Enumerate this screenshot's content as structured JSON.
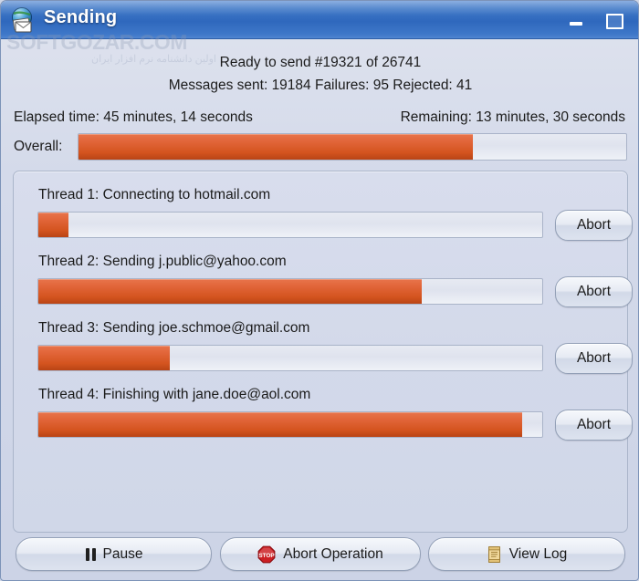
{
  "window": {
    "title": "Sending",
    "icon": "mail-globe-icon",
    "controls": {
      "minimize": "minimize-icon",
      "maximize": "maximize-icon"
    }
  },
  "watermark": {
    "main": "SOFTGOZAR.COM",
    "sub": "اولین دانشنامه نرم افزار ایران"
  },
  "status": {
    "ready_line": "Ready to send #19321 of 26741",
    "counts_line": "Messages sent: 19184  Failures: 95  Rejected: 41",
    "elapsed": "Elapsed time: 45 minutes, 14 seconds",
    "remaining": "Remaining: 13 minutes, 30 seconds",
    "overall_label": "Overall:",
    "overall_percent": 72
  },
  "threads": [
    {
      "label": "Thread 1:  Connecting to hotmail.com",
      "percent": 6,
      "abort_label": "Abort"
    },
    {
      "label": "Thread 2:  Sending j.public@yahoo.com",
      "percent": 76,
      "abort_label": "Abort"
    },
    {
      "label": "Thread 3:  Sending joe.schmoe@gmail.com",
      "percent": 26,
      "abort_label": "Abort"
    },
    {
      "label": "Thread 4:  Finishing with jane.doe@aol.com",
      "percent": 96,
      "abort_label": "Abort"
    }
  ],
  "actions": {
    "pause": "Pause",
    "abort_operation": "Abort Operation",
    "view_log": "View Log",
    "pause_icon": "pause-icon",
    "abort_icon": "stop-sign-icon",
    "view_log_icon": "scroll-document-icon"
  },
  "colors": {
    "titlebar": "#3f78c9",
    "progress_fill": "#d4541f",
    "progress_track": "#dfe3ee",
    "window_bg": "#d4daea",
    "stop_red": "#cc1f24",
    "scroll_tan": "#e8c887"
  }
}
